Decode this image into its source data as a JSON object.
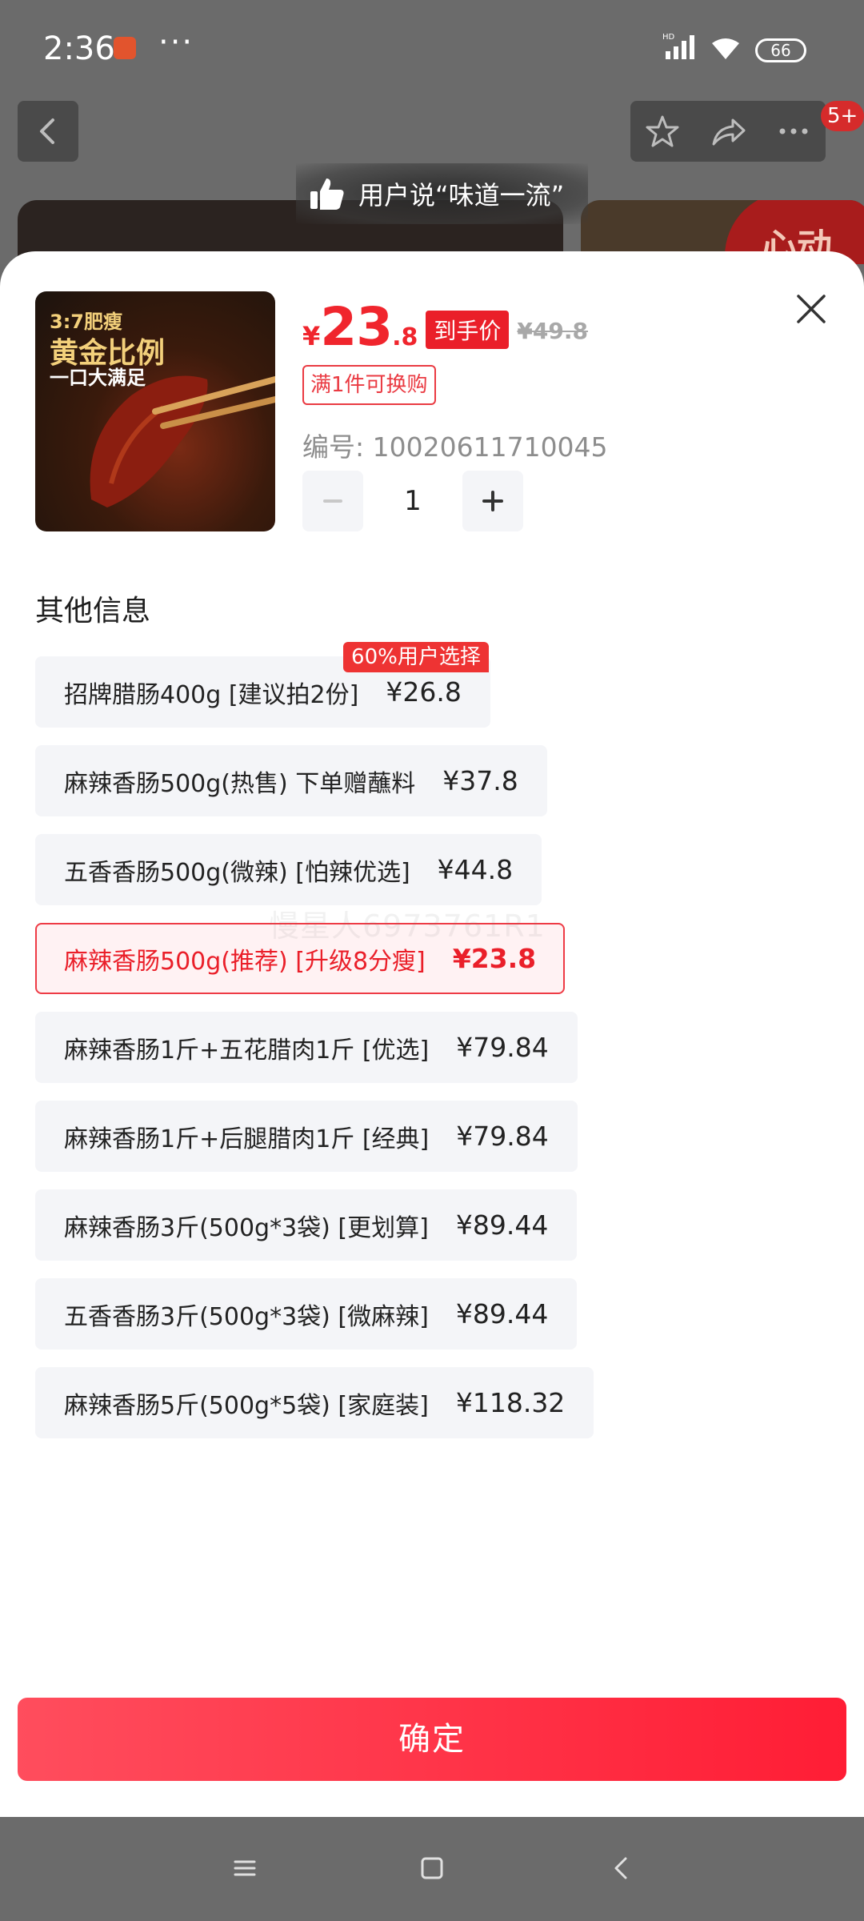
{
  "status_bar": {
    "time": "2:36",
    "more": "···",
    "signal_label": "HD",
    "battery": "66"
  },
  "top_nav": {
    "badge": "5+"
  },
  "background": {
    "praise": "用户说“味道一流”",
    "right_card_text": "心动"
  },
  "product": {
    "image_text": [
      "3:7肥瘦",
      "黄金比例",
      "一口大满足"
    ],
    "price_currency": "¥",
    "price_int": "23",
    "price_dec": ".8",
    "price_tag": "到手价",
    "original_price": "¥49.8",
    "promo": "满1件可换购",
    "sku": "编号: 10020611710045",
    "quantity": "1"
  },
  "section_title": "其他信息",
  "options": [
    {
      "name": "招牌腊肠400g [建议拍2份]",
      "price": "¥26.8",
      "tag": "60%用户选择",
      "selected": false
    },
    {
      "name": "麻辣香肠500g(热售) 下单赠蘸料",
      "price": "¥37.8",
      "tag": "",
      "selected": false
    },
    {
      "name": "五香香肠500g(微辣) [怕辣优选]",
      "price": "¥44.8",
      "tag": "",
      "selected": false
    },
    {
      "name": "麻辣香肠500g(推荐) [升级8分瘦]",
      "price": "¥23.8",
      "tag": "",
      "selected": true
    },
    {
      "name": "麻辣香肠1斤+五花腊肉1斤 [优选]",
      "price": "¥79.84",
      "tag": "",
      "selected": false
    },
    {
      "name": "麻辣香肠1斤+后腿腊肉1斤 [经典]",
      "price": "¥79.84",
      "tag": "",
      "selected": false
    },
    {
      "name": "麻辣香肠3斤(500g*3袋) [更划算]",
      "price": "¥89.44",
      "tag": "",
      "selected": false
    },
    {
      "name": "五香香肠3斤(500g*3袋) [微麻辣]",
      "price": "¥89.44",
      "tag": "",
      "selected": false
    },
    {
      "name": "麻辣香肠5斤(500g*5袋) [家庭装]",
      "price": "¥118.32",
      "tag": "",
      "selected": false
    }
  ],
  "watermark": "慢星人6973761R1",
  "confirm_label": "确定",
  "icons": {
    "back": "back-arrow-icon",
    "star": "star-icon",
    "share": "share-icon",
    "more": "more-dots-icon",
    "close": "close-icon",
    "minus": "minus-icon",
    "plus": "plus-icon",
    "thumb": "thumbs-up-icon",
    "menu": "menu-icon",
    "home": "home-square-icon",
    "nav_back": "nav-back-icon"
  },
  "colors": {
    "accent": "#ea1f29",
    "price": "#f0252d",
    "selected_bg": "#fff2f3",
    "option_bg": "#f4f5f8"
  }
}
